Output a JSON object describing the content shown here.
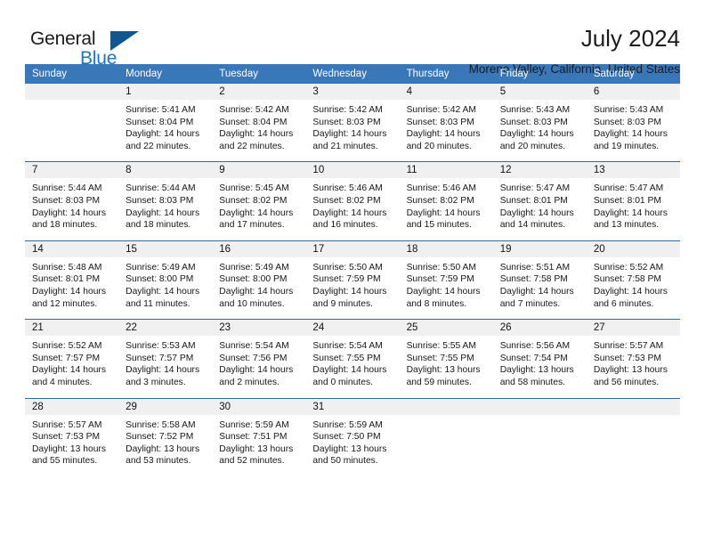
{
  "brand": {
    "name_part1": "General",
    "name_part2": "Blue",
    "triangle_color": "#10578f",
    "blue_color": "#1d76c4"
  },
  "header": {
    "title": "July 2024",
    "location": "Moreno Valley, California, United States"
  },
  "theme": {
    "header_row_bg": "#3a77b8",
    "daynum_bg": "#f0f0f0",
    "row_divider": "#2f6ba8"
  },
  "weekday_headers": [
    "Sunday",
    "Monday",
    "Tuesday",
    "Wednesday",
    "Thursday",
    "Friday",
    "Saturday"
  ],
  "weeks": [
    [
      {
        "day": "",
        "lines": []
      },
      {
        "day": "1",
        "lines": [
          "Sunrise: 5:41 AM",
          "Sunset: 8:04 PM",
          "Daylight: 14 hours",
          "and 22 minutes."
        ]
      },
      {
        "day": "2",
        "lines": [
          "Sunrise: 5:42 AM",
          "Sunset: 8:04 PM",
          "Daylight: 14 hours",
          "and 22 minutes."
        ]
      },
      {
        "day": "3",
        "lines": [
          "Sunrise: 5:42 AM",
          "Sunset: 8:03 PM",
          "Daylight: 14 hours",
          "and 21 minutes."
        ]
      },
      {
        "day": "4",
        "lines": [
          "Sunrise: 5:42 AM",
          "Sunset: 8:03 PM",
          "Daylight: 14 hours",
          "and 20 minutes."
        ]
      },
      {
        "day": "5",
        "lines": [
          "Sunrise: 5:43 AM",
          "Sunset: 8:03 PM",
          "Daylight: 14 hours",
          "and 20 minutes."
        ]
      },
      {
        "day": "6",
        "lines": [
          "Sunrise: 5:43 AM",
          "Sunset: 8:03 PM",
          "Daylight: 14 hours",
          "and 19 minutes."
        ]
      }
    ],
    [
      {
        "day": "7",
        "lines": [
          "Sunrise: 5:44 AM",
          "Sunset: 8:03 PM",
          "Daylight: 14 hours",
          "and 18 minutes."
        ]
      },
      {
        "day": "8",
        "lines": [
          "Sunrise: 5:44 AM",
          "Sunset: 8:03 PM",
          "Daylight: 14 hours",
          "and 18 minutes."
        ]
      },
      {
        "day": "9",
        "lines": [
          "Sunrise: 5:45 AM",
          "Sunset: 8:02 PM",
          "Daylight: 14 hours",
          "and 17 minutes."
        ]
      },
      {
        "day": "10",
        "lines": [
          "Sunrise: 5:46 AM",
          "Sunset: 8:02 PM",
          "Daylight: 14 hours",
          "and 16 minutes."
        ]
      },
      {
        "day": "11",
        "lines": [
          "Sunrise: 5:46 AM",
          "Sunset: 8:02 PM",
          "Daylight: 14 hours",
          "and 15 minutes."
        ]
      },
      {
        "day": "12",
        "lines": [
          "Sunrise: 5:47 AM",
          "Sunset: 8:01 PM",
          "Daylight: 14 hours",
          "and 14 minutes."
        ]
      },
      {
        "day": "13",
        "lines": [
          "Sunrise: 5:47 AM",
          "Sunset: 8:01 PM",
          "Daylight: 14 hours",
          "and 13 minutes."
        ]
      }
    ],
    [
      {
        "day": "14",
        "lines": [
          "Sunrise: 5:48 AM",
          "Sunset: 8:01 PM",
          "Daylight: 14 hours",
          "and 12 minutes."
        ]
      },
      {
        "day": "15",
        "lines": [
          "Sunrise: 5:49 AM",
          "Sunset: 8:00 PM",
          "Daylight: 14 hours",
          "and 11 minutes."
        ]
      },
      {
        "day": "16",
        "lines": [
          "Sunrise: 5:49 AM",
          "Sunset: 8:00 PM",
          "Daylight: 14 hours",
          "and 10 minutes."
        ]
      },
      {
        "day": "17",
        "lines": [
          "Sunrise: 5:50 AM",
          "Sunset: 7:59 PM",
          "Daylight: 14 hours",
          "and 9 minutes."
        ]
      },
      {
        "day": "18",
        "lines": [
          "Sunrise: 5:50 AM",
          "Sunset: 7:59 PM",
          "Daylight: 14 hours",
          "and 8 minutes."
        ]
      },
      {
        "day": "19",
        "lines": [
          "Sunrise: 5:51 AM",
          "Sunset: 7:58 PM",
          "Daylight: 14 hours",
          "and 7 minutes."
        ]
      },
      {
        "day": "20",
        "lines": [
          "Sunrise: 5:52 AM",
          "Sunset: 7:58 PM",
          "Daylight: 14 hours",
          "and 6 minutes."
        ]
      }
    ],
    [
      {
        "day": "21",
        "lines": [
          "Sunrise: 5:52 AM",
          "Sunset: 7:57 PM",
          "Daylight: 14 hours",
          "and 4 minutes."
        ]
      },
      {
        "day": "22",
        "lines": [
          "Sunrise: 5:53 AM",
          "Sunset: 7:57 PM",
          "Daylight: 14 hours",
          "and 3 minutes."
        ]
      },
      {
        "day": "23",
        "lines": [
          "Sunrise: 5:54 AM",
          "Sunset: 7:56 PM",
          "Daylight: 14 hours",
          "and 2 minutes."
        ]
      },
      {
        "day": "24",
        "lines": [
          "Sunrise: 5:54 AM",
          "Sunset: 7:55 PM",
          "Daylight: 14 hours",
          "and 0 minutes."
        ]
      },
      {
        "day": "25",
        "lines": [
          "Sunrise: 5:55 AM",
          "Sunset: 7:55 PM",
          "Daylight: 13 hours",
          "and 59 minutes."
        ]
      },
      {
        "day": "26",
        "lines": [
          "Sunrise: 5:56 AM",
          "Sunset: 7:54 PM",
          "Daylight: 13 hours",
          "and 58 minutes."
        ]
      },
      {
        "day": "27",
        "lines": [
          "Sunrise: 5:57 AM",
          "Sunset: 7:53 PM",
          "Daylight: 13 hours",
          "and 56 minutes."
        ]
      }
    ],
    [
      {
        "day": "28",
        "lines": [
          "Sunrise: 5:57 AM",
          "Sunset: 7:53 PM",
          "Daylight: 13 hours",
          "and 55 minutes."
        ]
      },
      {
        "day": "29",
        "lines": [
          "Sunrise: 5:58 AM",
          "Sunset: 7:52 PM",
          "Daylight: 13 hours",
          "and 53 minutes."
        ]
      },
      {
        "day": "30",
        "lines": [
          "Sunrise: 5:59 AM",
          "Sunset: 7:51 PM",
          "Daylight: 13 hours",
          "and 52 minutes."
        ]
      },
      {
        "day": "31",
        "lines": [
          "Sunrise: 5:59 AM",
          "Sunset: 7:50 PM",
          "Daylight: 13 hours",
          "and 50 minutes."
        ]
      },
      {
        "day": "",
        "lines": []
      },
      {
        "day": "",
        "lines": []
      },
      {
        "day": "",
        "lines": []
      }
    ]
  ]
}
